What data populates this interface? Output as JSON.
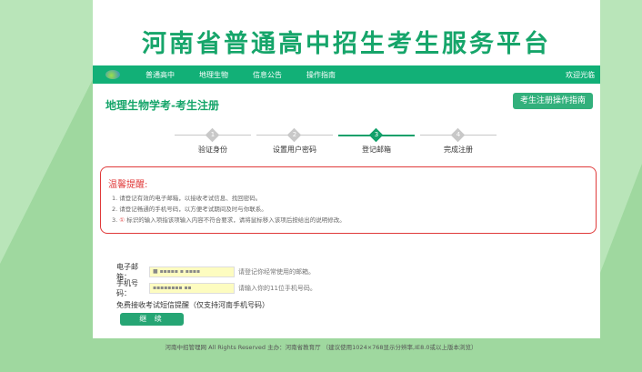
{
  "site_title": "河南省普通高中招生考生服务平台",
  "nav": {
    "items": [
      "普通高中",
      "地理生物",
      "信息公告",
      "操作指南"
    ],
    "welcome": "欢迎光临"
  },
  "page_title": "地理生物学考-考生注册",
  "guide_button": "考生注册操作指南",
  "steps": [
    {
      "num": "1",
      "label": "验证身份"
    },
    {
      "num": "2",
      "label": "设置用户密码"
    },
    {
      "num": "3",
      "label": "登记邮箱"
    },
    {
      "num": "4",
      "label": "完成注册"
    }
  ],
  "active_step": 3,
  "tips": {
    "title": "温馨提醒:",
    "items": [
      "1. 请登记有效的电子邮箱，以接收考试信息、找回密码。",
      "2. 请登记畅通的手机号码，以方便考试期间及时与你联系。",
      "标识的输入项指该项输入内容不符合要求，请将鼠标移入该项后按给出的说明修改。"
    ],
    "item3_prefix": "3.",
    "warn_icon": "①"
  },
  "form": {
    "email_label": "电子邮箱：",
    "email_value": "■ ▪▪▪▪▪ ▪ ▪▪▪▪",
    "email_hint": "请登记你经常使用的邮箱。",
    "phone_label": "手机号码：",
    "phone_value": "▪▪▪▪▪▪▪▪ ▪▪",
    "phone_hint": "请输入你的11位手机号码。",
    "sms_label": "免费接收考试短信提醒（仅支持河南手机号码）"
  },
  "continue_button": "继 续",
  "footer": "河南中招管理网 All Rights Reserved 主办：河南省教育厅 （建议使用1024×768显示分辨率,IE8.0或以上版本浏览）"
}
